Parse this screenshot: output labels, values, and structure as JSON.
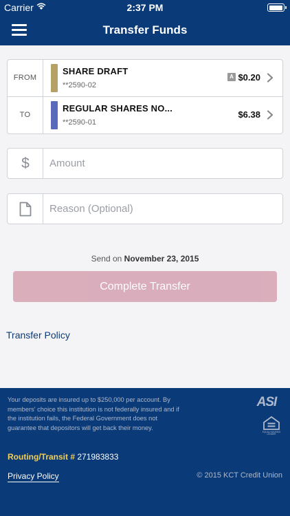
{
  "status_bar": {
    "carrier": "Carrier",
    "time": "2:37 PM",
    "battery_level": 1.0
  },
  "header": {
    "title": "Transfer Funds",
    "menu_icon": "hamburger-menu-icon"
  },
  "accounts": {
    "from": {
      "label": "FROM",
      "name": "SHARE DRAFT",
      "number": "**2590-02",
      "badge": "A",
      "balance": "$0.20",
      "color": "#b5a165"
    },
    "to": {
      "label": "TO",
      "name": "REGULAR SHARES NO...",
      "number": "**2590-01",
      "balance": "$6.38",
      "color": "#5a6aba"
    }
  },
  "amount": {
    "icon": "$",
    "placeholder": "Amount",
    "value": ""
  },
  "reason": {
    "icon": "document-icon",
    "placeholder": "Reason (Optional)",
    "value": ""
  },
  "send_on": {
    "prefix": "Send on",
    "date": "November 23, 2015"
  },
  "complete_button": {
    "label": "Complete Transfer",
    "color": "#d8a6b6"
  },
  "links": {
    "transfer_policy": "Transfer Policy"
  },
  "footer": {
    "disclaimer": "Your deposits are insured up to $250,000 per account. By members' choice this institution is not federally insured and if the institution fails, the Federal Government does not guarantee that depositors will get back their money.",
    "routing_label": "Routing/Transit #",
    "routing_number": "271983833",
    "privacy_policy": "Privacy Policy",
    "copyright": "© 2015 KCT Credit Union",
    "logos": [
      "ASI",
      "EQUAL HOUSING LENDER"
    ]
  },
  "colors": {
    "brand": "#0a3a78",
    "background": "#f4f4f6",
    "routing_label": "#f2cf57"
  }
}
